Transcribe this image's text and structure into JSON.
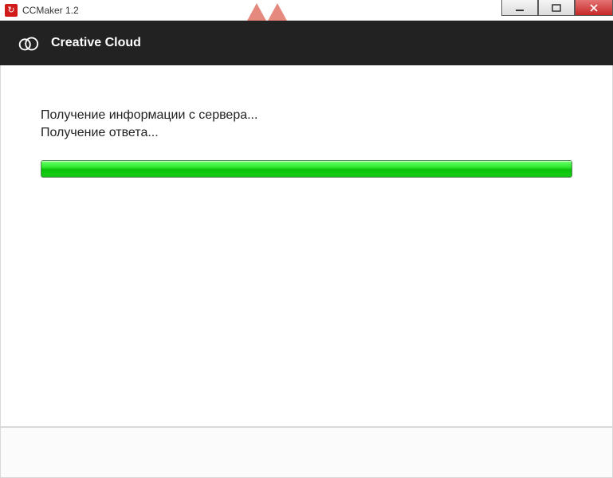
{
  "window": {
    "title": "CCMaker 1.2"
  },
  "banner": {
    "title": "Creative Cloud"
  },
  "status": {
    "line1": "Получение информации с сервера...",
    "line2": "Получение ответа..."
  },
  "progress": {
    "value_percent": 100
  }
}
